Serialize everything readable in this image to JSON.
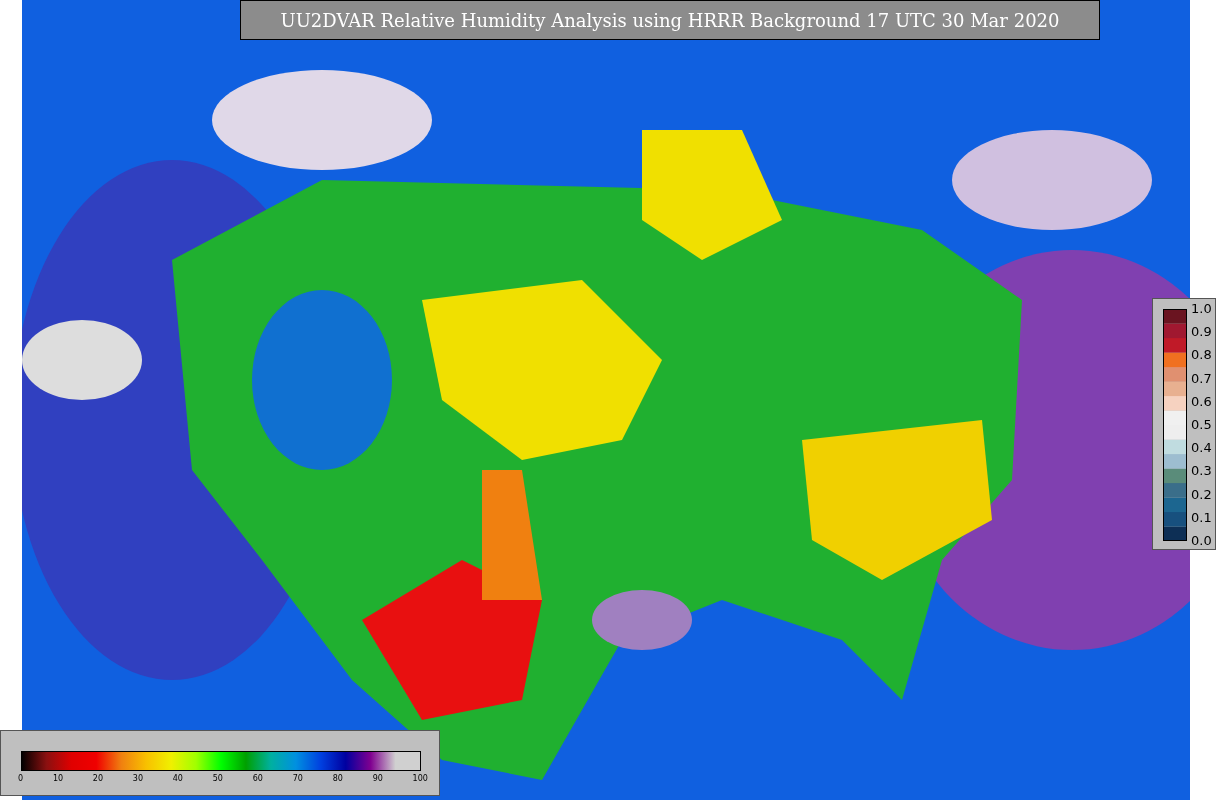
{
  "title": "UU2DVAR Relative Humidity Analysis using HRRR Background 17 UTC 30 Mar 2020",
  "ratio_legend": {
    "ticks": [
      "1.0",
      "0.9",
      "0.8",
      "0.7",
      "0.6",
      "0.5",
      "0.4",
      "0.3",
      "0.2",
      "0.1",
      "0.0"
    ]
  },
  "humidity_legend": {
    "ticks": [
      "0",
      "10",
      "20",
      "30",
      "40",
      "50",
      "60",
      "70",
      "80",
      "90",
      "100"
    ]
  }
}
